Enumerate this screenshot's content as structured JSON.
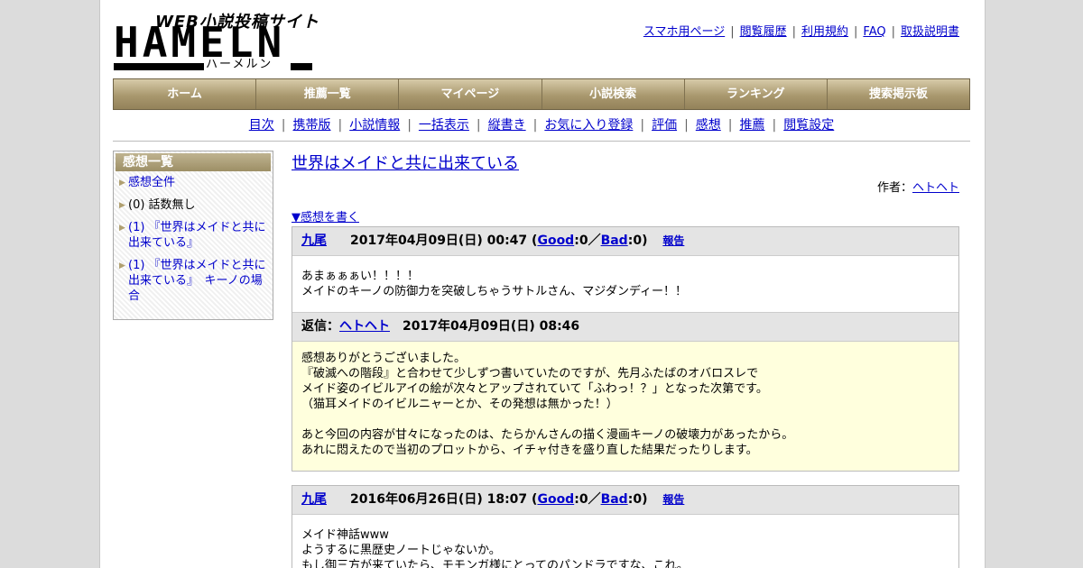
{
  "logo": {
    "tagline": "WEB小説投稿サイト",
    "main": "HAMELN",
    "kana": "ハーメルン"
  },
  "top_links": [
    "スマホ用ページ",
    "閲覧履歴",
    "利用規約",
    "FAQ",
    "取扱説明書"
  ],
  "nav": [
    "ホーム",
    "推薦一覧",
    "マイページ",
    "小説検索",
    "ランキング",
    "捜索掲示板"
  ],
  "subnav": [
    "目次",
    "携帯版",
    "小説情報",
    "一括表示",
    "縦書き",
    "お気に入り登録",
    "評価",
    "感想",
    "推薦",
    "閲覧設定"
  ],
  "sidebar": {
    "title": "感想一覧",
    "items": [
      {
        "label": "感想全件",
        "link": true
      },
      {
        "label": "(0) 話数無し",
        "link": false
      },
      {
        "label": "(1) 『世界はメイドと共に出来ている』",
        "link": true
      },
      {
        "label": "(1) 『世界はメイドと共に出来ている』　キーノの場合",
        "link": true
      }
    ]
  },
  "novel": {
    "title": "世界はメイドと共に出来ている",
    "author_label": "作者：",
    "author": "ヘトヘト",
    "write_link": "▼感想を書く"
  },
  "labels": {
    "good": "Good",
    "bad": "Bad",
    "report": "報告",
    "reply_prefix": "返信："
  },
  "reviews": [
    {
      "user": "九尾",
      "date": "2017年04月09日(日) 00:47",
      "good": "0",
      "bad": "0",
      "body": [
        "あまぁぁぁい！！！！",
        "メイドのキーノの防御力を突破しちゃうサトルさん、マジダンディー！！"
      ],
      "reply": {
        "user": "ヘトヘト",
        "date": "2017年04月09日(日) 08:46",
        "body": [
          "感想ありがとうございました。",
          "『破滅への階段』と合わせて少しずつ書いていたのですが、先月ふたばのオバロスレで",
          "メイド姿のイビルアイの絵が次々とアップされていて「ふわっ！？」となった次第です。",
          "（猫耳メイドのイビルニャーとか、その発想は無かった！）",
          "",
          "あと今回の内容が甘々になったのは、たらかんさんの描く漫画キーノの破壊力があったから。",
          "あれに悶えたので当初のプロットから、イチャ付きを盛り直した結果だったりします。"
        ]
      }
    },
    {
      "user": "九尾",
      "date": "2016年06月26日(日) 18:07",
      "good": "0",
      "bad": "0",
      "body": [
        "メイド神話www",
        "ようするに黒歴史ノートじゃないか。",
        "もし御三方が来ていたら、モモンガ様にとってのパンドラですな、これ。"
      ]
    }
  ]
}
